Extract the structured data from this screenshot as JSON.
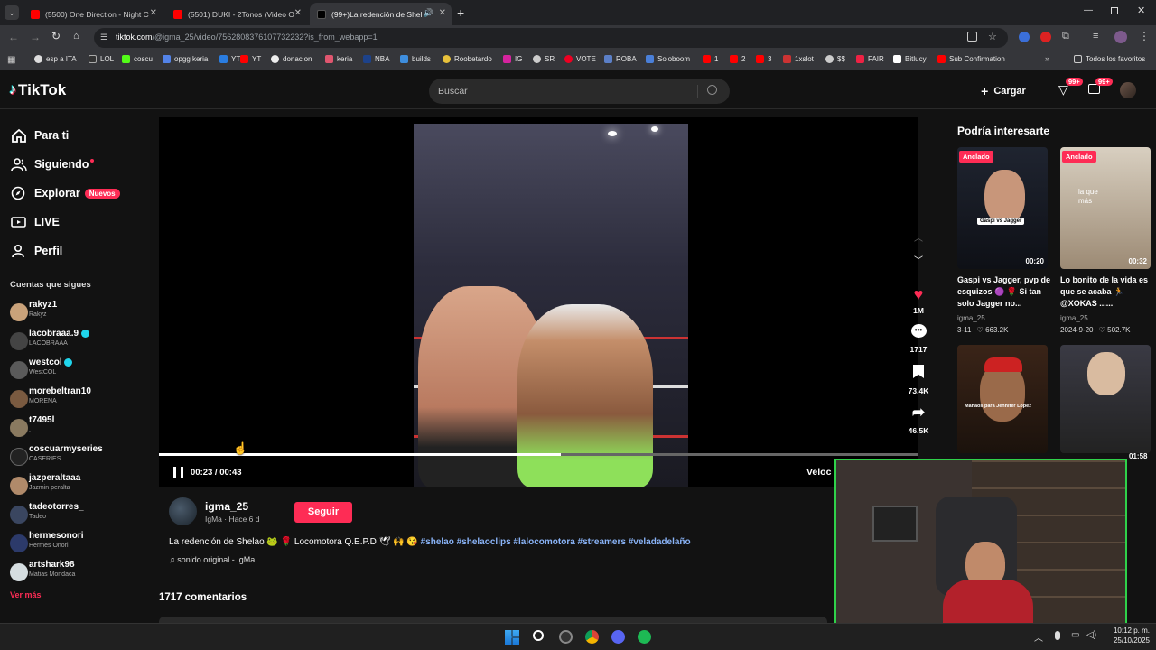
{
  "browser": {
    "tabs": [
      {
        "title": "(5500) One Direction - Night C"
      },
      {
        "title": "(5501) DUKI - 2Tonos (Video O"
      },
      {
        "title": "(99+)La redención de Shela"
      }
    ],
    "url_host": "tiktok.com",
    "url_path": "/@igma_25/video/7562808376107732232?is_from_webapp=1",
    "bookmarks": [
      "esp a ITA",
      "LOL",
      "coscu",
      "opgg keria",
      "YT",
      "donacion",
      "keria",
      "NBA",
      "builds",
      "Roobetardo",
      "IG",
      "SR",
      "VOTE",
      "ROBA",
      "Soloboom",
      "1",
      "2",
      "3",
      "1xslot",
      "$$",
      "FAIR",
      "Bitlucy",
      "Sub Confirmation"
    ],
    "all_bookmarks": "Todos los favoritos"
  },
  "header": {
    "logo": "TikTok",
    "search_placeholder": "Buscar",
    "upload": "Cargar",
    "badge1": "99+",
    "badge2": "99+"
  },
  "nav": {
    "for_you": "Para ti",
    "following": "Siguiendo",
    "explore": "Explorar",
    "new_badge": "Nuevos",
    "live": "LIVE",
    "profile": "Perfil"
  },
  "following_title": "Cuentas que sigues",
  "accounts": [
    {
      "name": "rakyz1",
      "sub": "Rakyz"
    },
    {
      "name": "lacobraaa.9",
      "sub": "LACOBRAAA"
    },
    {
      "name": "westcol",
      "sub": "WestCOL"
    },
    {
      "name": "morebeltran10",
      "sub": "MORENA"
    },
    {
      "name": "t7495l",
      "sub": "."
    },
    {
      "name": "coscuarmyseries",
      "sub": "CASERIES"
    },
    {
      "name": "jazperaltaaa",
      "sub": "Jazmin peralta"
    },
    {
      "name": "tadeotorres_",
      "sub": "Tadeo"
    },
    {
      "name": "hermesonori",
      "sub": "Hermes Onori"
    },
    {
      "name": "artshark98",
      "sub": "Matias Mondaca"
    }
  ],
  "see_more": "Ver más",
  "video": {
    "time": "00:23 / 00:43",
    "progress": 0.53,
    "speed_label": "Veloc",
    "likes": "1M",
    "comments": "1717",
    "saves": "73.4K",
    "shares": "46.5K"
  },
  "author": {
    "handle": "igma_25",
    "meta": "IgMa · Hace 6 d",
    "follow": "Seguir"
  },
  "caption": {
    "text": "La redención de Shelao",
    "text2": "Locomotora Q.E.P.D",
    "hashtags": "#shelao #shelaoclips #lalocomotora #streamers #veladadelaño",
    "sound": "♫ sonido original - IgMa"
  },
  "comments_count": "1717 comentarios",
  "suggestions": {
    "title": "Podría interesarte",
    "items": [
      {
        "pinned": "Anclado",
        "duration": "00:20",
        "overlay": "Gaspi vs Jagger",
        "title": "Gaspi vs Jagger, pvp de esquizos",
        "title2": "Si tan solo Jagger no...",
        "author": "igma_25",
        "date": "3-11",
        "likes": "663.2K"
      },
      {
        "pinned": "Anclado",
        "duration": "00:32",
        "overlay": "la que más",
        "title": "Lo bonito de la vida es que se acaba",
        "title2": "@XOKAS ......",
        "author": "igma_25",
        "date": "2024-9-20",
        "likes": "502.7K"
      },
      {
        "overlay": "Manaos para Jennifer Lopez"
      },
      {
        "duration": "01:58"
      }
    ]
  },
  "taskbar": {
    "time": "10:12 p. m.",
    "date": "25/10/2025"
  }
}
